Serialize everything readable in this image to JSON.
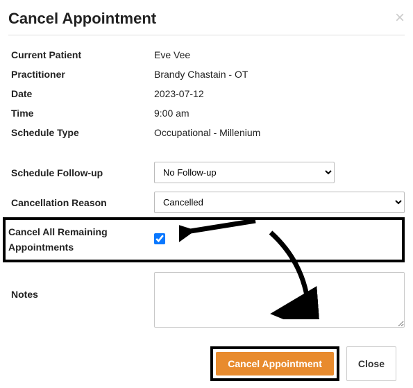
{
  "header": {
    "title": "Cancel Appointment"
  },
  "details": {
    "current_patient_label": "Current Patient",
    "current_patient_value": "Eve Vee",
    "practitioner_label": "Practitioner",
    "practitioner_value": "Brandy Chastain - OT",
    "date_label": "Date",
    "date_value": "2023-07-12",
    "time_label": "Time",
    "time_value": "9:00 am",
    "schedule_type_label": "Schedule Type",
    "schedule_type_value": "Occupational - Millenium"
  },
  "form": {
    "followup_label": "Schedule Follow-up",
    "followup_selected": "No Follow-up",
    "reason_label": "Cancellation Reason",
    "reason_selected": "Cancelled",
    "cancel_all_label": "Cancel All Remaining Appointments",
    "cancel_all_checked": true,
    "notes_label": "Notes",
    "notes_value": ""
  },
  "footer": {
    "primary_label": "Cancel Appointment",
    "close_label": "Close"
  }
}
